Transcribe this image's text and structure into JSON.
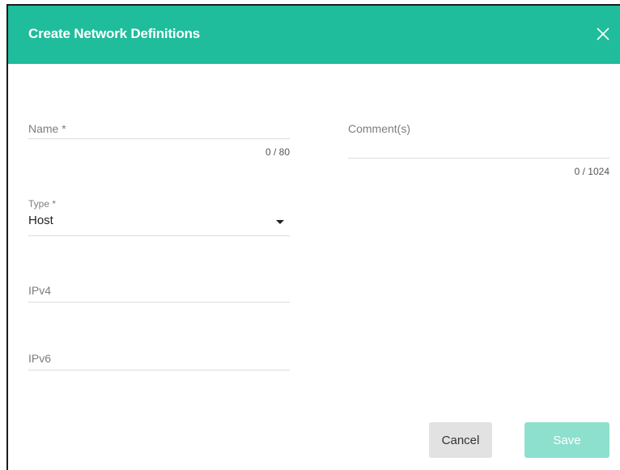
{
  "dialog": {
    "title": "Create Network Definitions",
    "close_icon": "close-icon",
    "colors": {
      "header": "#1fbd9b",
      "save_disabled": "#8de0ce",
      "cancel": "#e2e2e2"
    }
  },
  "form": {
    "name": {
      "label": "Name *",
      "value": "",
      "counter": "0 / 80"
    },
    "comments": {
      "label": "Comment(s)",
      "value": "",
      "counter": "0 / 1024"
    },
    "type": {
      "label": "Type *",
      "selected": "Host",
      "dropdown_icon": "caret-down-icon"
    },
    "ipv4": {
      "label": "IPv4",
      "value": ""
    },
    "ipv6": {
      "label": "IPv6",
      "value": ""
    }
  },
  "actions": {
    "cancel_label": "Cancel",
    "save_label": "Save"
  }
}
